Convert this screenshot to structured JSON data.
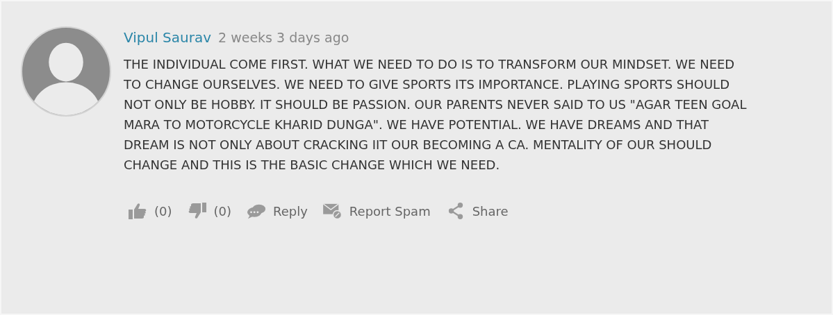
{
  "comment": {
    "author": "Vipul Saurav",
    "time": "2 weeks 3 days ago",
    "text": "THE INDIVIDUAL COME FIRST. WHAT WE NEED TO DO IS TO TRANSFORM OUR MINDSET. WE NEED TO CHANGE OURSELVES. WE NEED TO GIVE SPORTS ITS IMPORTANCE. PLAYING SPORTS SHOULD NOT ONLY BE HOBBY. IT SHOULD BE PASSION. OUR PARENTS NEVER SAID TO US \"AGAR TEEN GOAL MARA TO MOTORCYCLE KHARID DUNGA\". WE HAVE POTENTIAL. WE HAVE DREAMS AND THAT DREAM IS NOT ONLY ABOUT CRACKING IIT OUR BECOMING A CA. MENTALITY OF OUR SHOULD CHANGE AND THIS IS THE BASIC CHANGE WHICH WE NEED.",
    "actions": [
      {
        "kind": "like",
        "label": "(0)"
      },
      {
        "kind": "dislike",
        "label": "(0)"
      },
      {
        "kind": "reply",
        "label": "Reply"
      },
      {
        "kind": "spam",
        "label": "Report Spam"
      },
      {
        "kind": "share",
        "label": "Share"
      }
    ]
  }
}
